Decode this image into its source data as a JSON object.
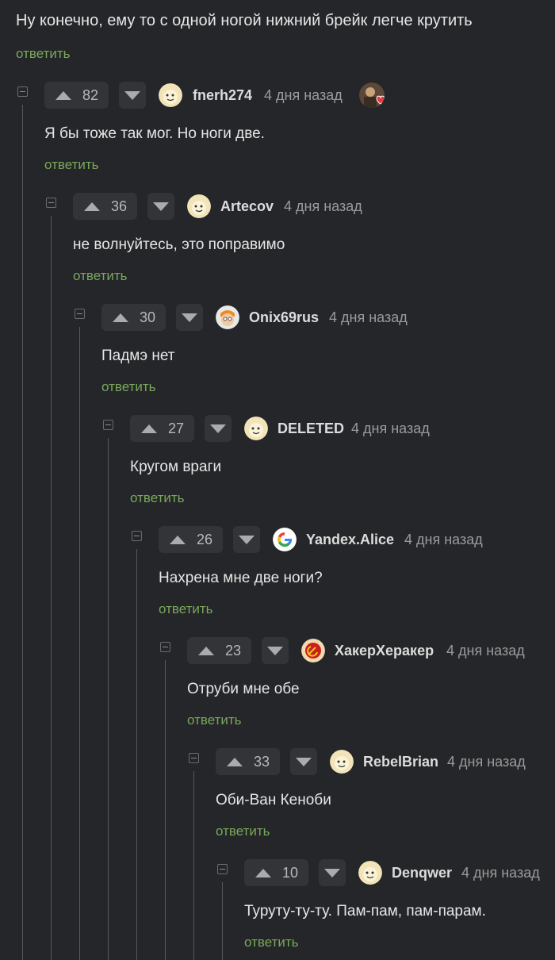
{
  "top_comment": {
    "text": "Ну конечно, ему то с одной ногой нижний брейк легче крутить",
    "reply_label": "ответить"
  },
  "comments": [
    {
      "votes": "82",
      "user": "fnerh274",
      "time": "4 дня назад",
      "text": "Я бы тоже так мог. Но ноги две.",
      "reply_label": "ответить",
      "avatar": "pikabu-avatar"
    },
    {
      "votes": "36",
      "user": "Artecov",
      "time": "4 дня назад",
      "text": "не волнуйтесь, это поправимо",
      "reply_label": "ответить",
      "avatar": "pikabu-avatar"
    },
    {
      "votes": "30",
      "user": "Onix69rus",
      "time": "4 дня назад",
      "text": "Падмэ нет",
      "reply_label": "ответить",
      "avatar": "fry-avatar"
    },
    {
      "votes": "27",
      "user": "DELETED",
      "time": "4 дня назад",
      "text": "Кругом враги",
      "reply_label": "ответить",
      "avatar": "pikabu-avatar"
    },
    {
      "votes": "26",
      "user": "Yandex.Alice",
      "time": "4 дня назад",
      "text": "Нахрена мне две ноги?",
      "reply_label": "ответить",
      "avatar": "google-avatar"
    },
    {
      "votes": "23",
      "user": "ХакерХеракер",
      "time": "4 дня назад",
      "text": "Отруби мне обе",
      "reply_label": "ответить",
      "avatar": "hammer-sickle-avatar"
    },
    {
      "votes": "33",
      "user": "RebelBrian",
      "time": "4 дня назад",
      "text": "Оби-Ван Кеноби",
      "reply_label": "ответить",
      "avatar": "pikabu-avatar"
    },
    {
      "votes": "10",
      "user": "Denqwer",
      "time": "4 дня назад",
      "text": "Туруту-ту-ту. Пам-пам, пам-парам.",
      "reply_label": "ответить",
      "avatar": "pikabu-avatar"
    }
  ],
  "colors": {
    "background": "#252629",
    "reply_link": "#7aa85a",
    "vote_box": "#323438"
  }
}
